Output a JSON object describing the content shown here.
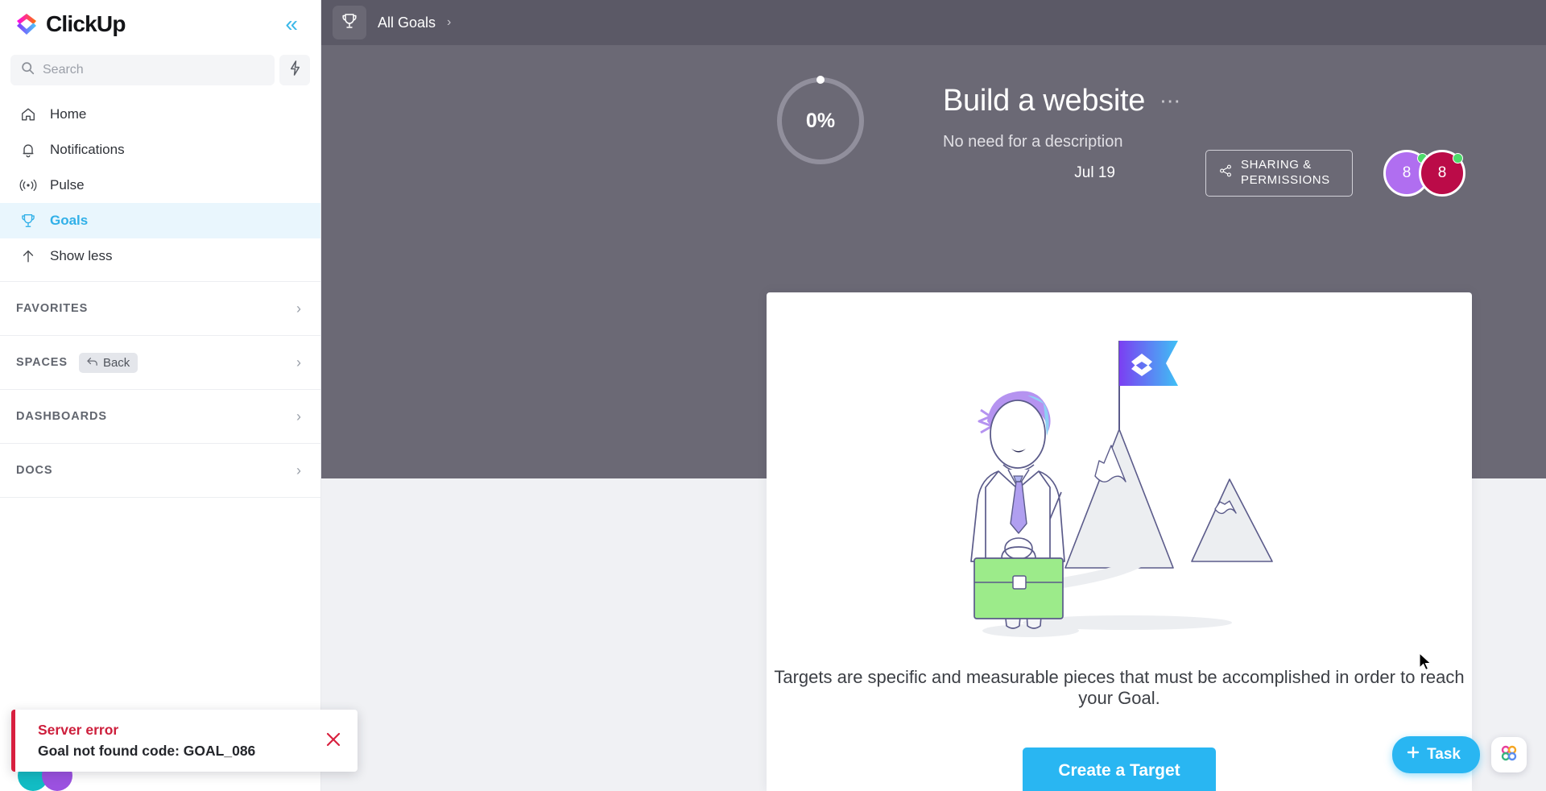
{
  "sidebar": {
    "brand": "ClickUp",
    "collapse_icon": "chevron-double-left-icon",
    "search": {
      "placeholder": "Search",
      "value": "",
      "icon": "search-icon"
    },
    "bolt_icon": "lightning-bolt-icon",
    "nav": [
      {
        "label": "Home",
        "icon": "home-icon",
        "active": false
      },
      {
        "label": "Notifications",
        "icon": "bell-icon",
        "active": false
      },
      {
        "label": "Pulse",
        "icon": "pulse-icon",
        "active": false
      },
      {
        "label": "Goals",
        "icon": "trophy-icon",
        "active": true
      },
      {
        "label": "Show less",
        "icon": "arrow-up-icon",
        "active": false
      }
    ],
    "sections": [
      {
        "title": "FAVORITES",
        "pill": null
      },
      {
        "title": "SPACES",
        "pill": "Back",
        "pill_icon": "back-arrow-icon"
      },
      {
        "title": "DASHBOARDS",
        "pill": null
      },
      {
        "title": "DOCS",
        "pill": null
      }
    ],
    "active_color": "#31b0e8",
    "active_bg": "#e9f6fd"
  },
  "toast": {
    "title": "Server error",
    "message": "Goal not found code: GOAL_086",
    "close_icon": "close-icon",
    "accent_color": "#d81f3f",
    "avatars": [
      {
        "color": "#12bcc4"
      },
      {
        "color": "#9b51e0"
      }
    ]
  },
  "topbar": {
    "icon": "trophy-icon",
    "breadcrumb": "All Goals",
    "separator": "›"
  },
  "goal": {
    "progress_label": "0%",
    "progress_value": 0,
    "title": "Build a website",
    "menu_icon": "ellipsis-icon",
    "description": "No need for a description",
    "date": "Jul 19",
    "share_button": {
      "label": "SHARING & PERMISSIONS",
      "icon": "share-icon"
    },
    "members": [
      {
        "initial": "8",
        "color": "#b06ef0"
      },
      {
        "initial": "8",
        "color": "#bb0b48"
      }
    ],
    "header_bg": "#6b6975",
    "topbar_bg": "#5b5966"
  },
  "empty_state": {
    "illustration": "person-with-briefcase-mountain-flag-illustration",
    "text": "Targets are specific and measurable pieces that must be accomplished in order to reach your Goal.",
    "cta_label": "Create a Target",
    "cta_color": "#29b6f2"
  },
  "fabs": {
    "task_label": "Task",
    "task_icon": "plus-icon",
    "grid_icon": "apps-grid-icon",
    "grid_colors": [
      "#e8409a",
      "#f5a623",
      "#36b37e",
      "#5b8def"
    ]
  }
}
